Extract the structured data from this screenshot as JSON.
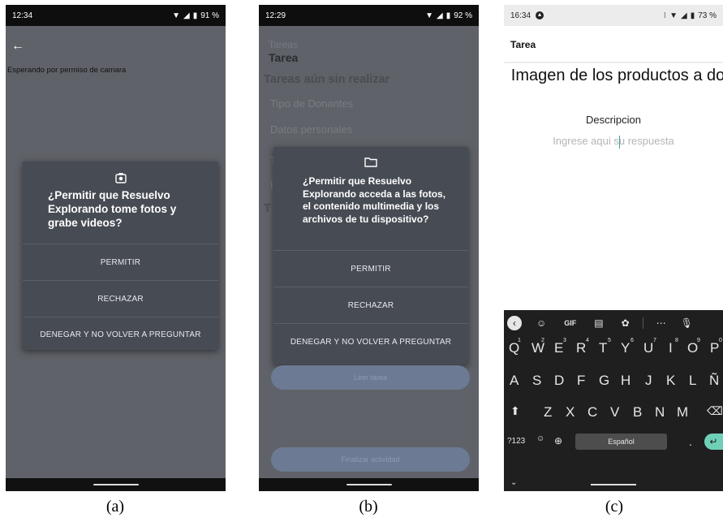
{
  "panel_a": {
    "status": {
      "time": "12:34",
      "battery": "91 %"
    },
    "back_icon": "arrow-left-icon",
    "waiting_text": "Esperando por permiso de camara",
    "dialog": {
      "icon": "camera-icon",
      "title": "¿Permitir que Resuelvo Explorando tome fotos y grabe videos?",
      "allow": "PERMITIR",
      "deny": "RECHAZAR",
      "deny_forever": "DENEGAR Y NO VOLVER A PREGUNTAR"
    },
    "caption": "(a)"
  },
  "panel_b": {
    "status": {
      "time": "12:29",
      "battery": "92 %"
    },
    "header_small": "Tareas",
    "header_title": "Tarea",
    "section_title": "Tareas aún sin realizar",
    "items": [
      "Tipo de Donantes",
      "Datos personales"
    ],
    "dialog": {
      "icon": "folder-icon",
      "title": "¿Permitir que Resuelvo Explorando acceda a las fotos, el contenido multimedia y los archivos de tu dispositivo?",
      "allow": "PERMITIR",
      "deny": "RECHAZAR",
      "deny_forever": "DENEGAR Y NO VOLVER A PREGUNTAR"
    },
    "button_read": "Leer tarea",
    "button_finish": "Finalizar actividad",
    "caption": "(b)"
  },
  "panel_c": {
    "status": {
      "time": "16:34",
      "battery": "73 %"
    },
    "title": "Tarea",
    "heading": "Imagen de los productos a donar",
    "label": "Descripcion",
    "input_placeholder": "Ingrese aqui su respuesta",
    "keyboard": {
      "row1": [
        "Q",
        "W",
        "E",
        "R",
        "T",
        "Y",
        "U",
        "I",
        "O",
        "P"
      ],
      "row1_hints": [
        "1",
        "2",
        "3",
        "4",
        "5",
        "6",
        "7",
        "8",
        "9",
        "0"
      ],
      "row2": [
        "A",
        "S",
        "D",
        "F",
        "G",
        "H",
        "J",
        "K",
        "L",
        "Ñ"
      ],
      "row3": [
        "Z",
        "X",
        "C",
        "V",
        "B",
        "N",
        "M"
      ],
      "numbers_key": "?123",
      "space_label": "Español",
      "period": ".",
      "gif": "GIF"
    },
    "caption": "(c)"
  },
  "colors": {
    "overlay": "#5f6268",
    "dialog": "#474b53",
    "keyboard": "#1f1f1f",
    "accent": "#6fd0b8"
  }
}
